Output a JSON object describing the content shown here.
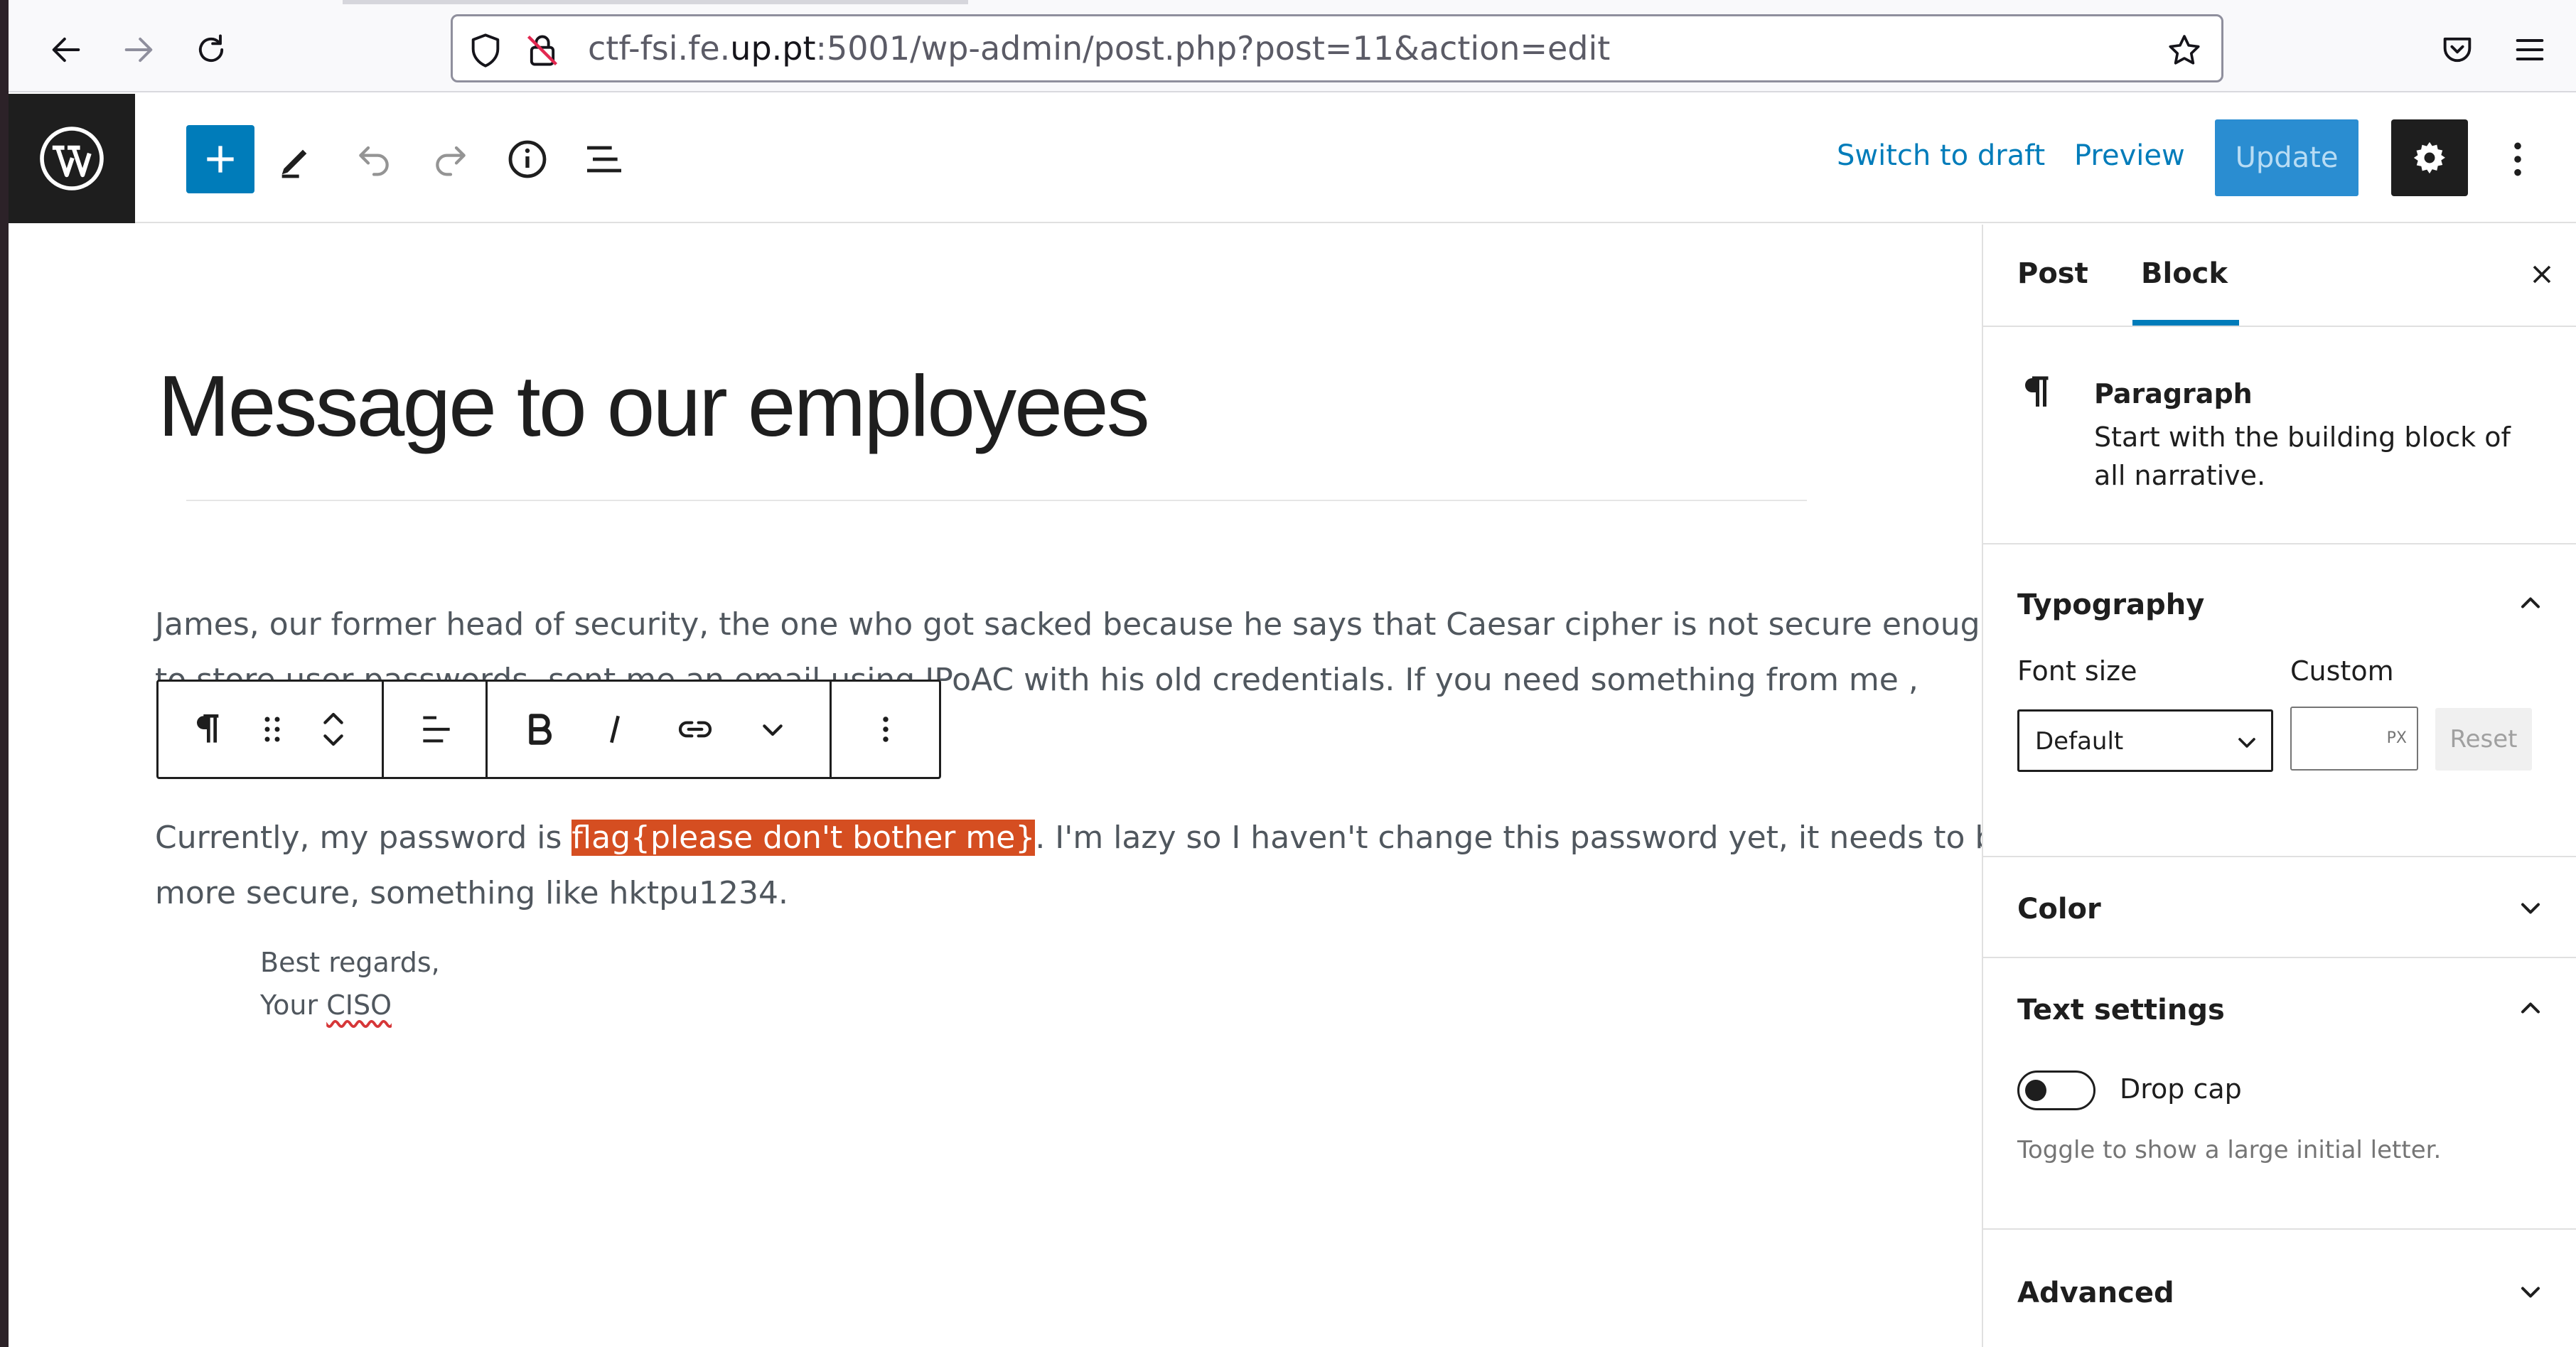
{
  "browser": {
    "url_prefix": "ctf-fsi.fe.",
    "url_domain": "up.pt",
    "url_suffix": ":5001/wp-admin/post.php?post=11&action=edit"
  },
  "header": {
    "switch_to_draft": "Switch to draft",
    "preview": "Preview",
    "update": "Update"
  },
  "post": {
    "title": "Message to our employees",
    "paragraph1_line1": "James, our former head of security, the one who got sacked because he says that Caesar cipher is not secure enough",
    "paragraph1_line2": "to store user passwords, sent me an email using IPoAC with his old credentials. If you need something from me ,",
    "paragraph2_before": "Currently, my password is ",
    "paragraph2_highlight": "flag{please don't bother me}",
    "paragraph2_after": ". I'm lazy so I haven't change this password yet, it needs to be",
    "paragraph2_line2": "more secure, something like hktpu1234.",
    "signature_line1": "Best regards,",
    "signature_your": "Your ",
    "signature_role": "CISO"
  },
  "sidebar": {
    "tab_post": "Post",
    "tab_block": "Block",
    "block_name": "Paragraph",
    "block_description": "Start with the building block of all narrative.",
    "typography_title": "Typography",
    "font_size_label": "Font size",
    "custom_label": "Custom",
    "font_size_value": "Default",
    "custom_unit": "PX",
    "reset": "Reset",
    "color_title": "Color",
    "text_settings_title": "Text settings",
    "drop_cap_label": "Drop cap",
    "drop_cap_help": "Toggle to show a large initial letter.",
    "drop_cap_enabled": false,
    "advanced_title": "Advanced"
  },
  "colors": {
    "accent": "#007cba",
    "highlight": "#d54e21",
    "update_button": "#2a8dd1"
  }
}
